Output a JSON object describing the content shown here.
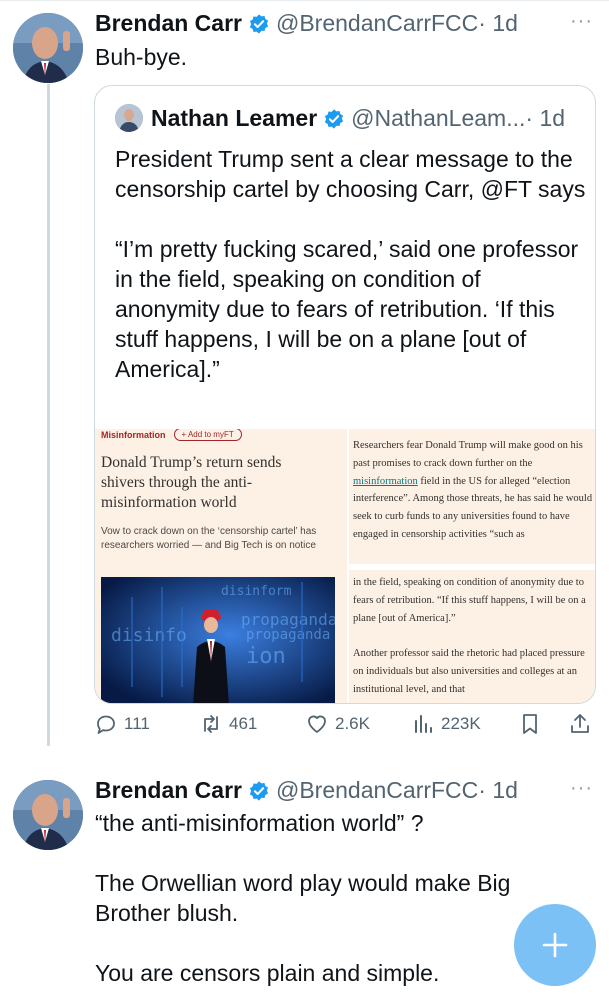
{
  "tweet1": {
    "author_name": "Brendan Carr",
    "handle": "@BrendanCarrFCC",
    "time": "· 1d",
    "more": "···",
    "text": "Buh-bye."
  },
  "quote": {
    "author_name": "Nathan Leamer",
    "handle": "@NathanLeam...",
    "time": "· 1d",
    "text": "President Trump sent a clear message to the censorship cartel by choosing Carr, @FT says\n\n“I’m pretty fucking scared,’ said one professor in the field, speaking on condition of anonymity due to fears of retribution. ‘If this stuff happens, I will be on a plane [out of America].”",
    "article": {
      "tag": "Misinformation",
      "add_button": "+ Add to myFT",
      "headline": "Donald Trump’s return sends shivers through the anti-misinformation world",
      "standfirst": "Vow to crack down on the ‘censorship cartel’ has researchers worried — and Big Tech is on notice",
      "col1_before_link": "Researchers fear Donald Trump will make good on his past promises to crack down further on the ",
      "col1_link": "misinformation",
      "col1_after_link": " field in the US for alleged “election interference”. Among those threats, he has said he would seek to curb funds to any universities found to have engaged in censorship activities “such as",
      "col2": "in the field, speaking on condition of anonymity due to fears of retribution. “If this stuff happens, I will be on a plane [out of America].”\n\nAnother professor said the rhetoric had placed pressure on individuals but also universities and colleges at an institutional level, and that",
      "photo_words": [
        "disinform",
        "propaganda",
        "disinfo",
        "propaganda",
        "ion"
      ]
    }
  },
  "actions": {
    "replies": "111",
    "retweets": "461",
    "likes": "2.6K",
    "views": "223K"
  },
  "tweet2": {
    "author_name": "Brendan Carr",
    "handle": "@BrendanCarrFCC",
    "time": "· 1d",
    "more": "···",
    "text": "“the anti-misinformation world” ?\n\nThe Orwellian word play would make Big Brother blush.\n\nYou are censors plain and simple."
  },
  "colors": {
    "verified": "#1d9bf0",
    "fab": "#7cc1f5",
    "ft_background": "#fdf1e5",
    "ft_red": "#a32626"
  }
}
